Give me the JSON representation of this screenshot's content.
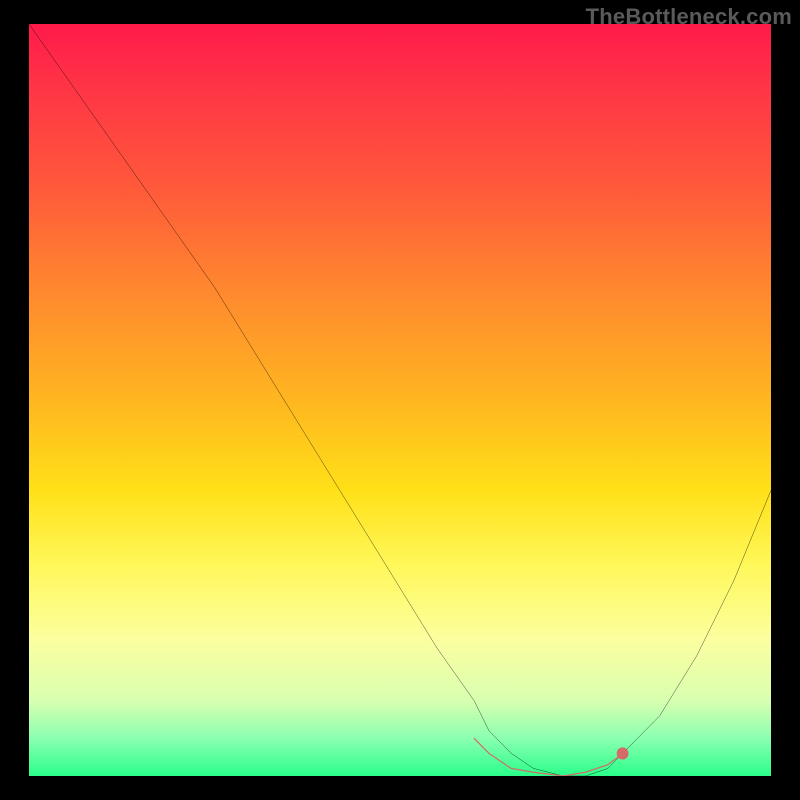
{
  "watermark": "TheBottleneck.com",
  "chart_data": {
    "type": "line",
    "title": "",
    "xlabel": "",
    "ylabel": "",
    "xlim": [
      0,
      100
    ],
    "ylim": [
      0,
      100
    ],
    "grid": false,
    "legend": false,
    "series": [
      {
        "name": "bottleneck-curve",
        "x": [
          0,
          5,
          10,
          15,
          20,
          25,
          30,
          35,
          40,
          45,
          50,
          55,
          60,
          62,
          65,
          68,
          72,
          75,
          78,
          80,
          85,
          90,
          95,
          100
        ],
        "values": [
          100,
          93,
          86,
          79,
          72,
          65,
          57,
          49,
          41,
          33,
          25,
          17,
          10,
          6,
          3,
          1,
          0,
          0,
          1,
          3,
          8,
          16,
          26,
          38
        ]
      }
    ],
    "highlight_segment": {
      "name": "valley-marker",
      "color": "#d46a6a",
      "x": [
        60,
        62,
        65,
        68,
        72,
        75,
        78,
        80
      ],
      "values": [
        5,
        3,
        1,
        0.5,
        0,
        0.5,
        1.5,
        3
      ]
    },
    "gradient_stops": [
      {
        "pos": 0,
        "color": "#ff1a4a"
      },
      {
        "pos": 22,
        "color": "#ff5a3a"
      },
      {
        "pos": 50,
        "color": "#ffb620"
      },
      {
        "pos": 72,
        "color": "#fff85a"
      },
      {
        "pos": 90,
        "color": "#d8ffb0"
      },
      {
        "pos": 100,
        "color": "#2aff8a"
      }
    ]
  }
}
